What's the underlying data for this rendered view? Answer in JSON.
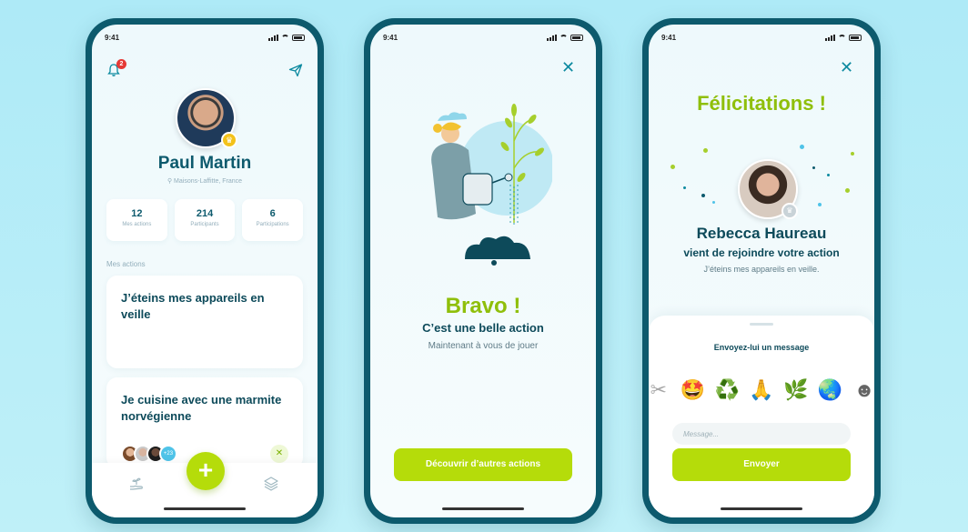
{
  "status_time": "9:41",
  "profile_screen": {
    "notification_count": "2",
    "user_name": "Paul Martin",
    "location": "Maisons-Laffitte, France",
    "stats": [
      {
        "value": "12",
        "label": "Mes actions"
      },
      {
        "value": "214",
        "label": "Participants"
      },
      {
        "value": "6",
        "label": "Participations"
      }
    ],
    "section_label": "Mes actions",
    "actions": [
      {
        "title": "J’éteins mes appareils en veille"
      },
      {
        "title": "Je cuisine avec une marmite norvégienne",
        "participants_more": "+23"
      }
    ],
    "fab_label": "+",
    "icons": {
      "notification": "bell-icon",
      "share": "paper-plane-icon",
      "tab_left": "plant-hand-icon",
      "tab_right": "layers-icon",
      "action": "utensils-icon"
    }
  },
  "bravo_screen": {
    "title": "Bravo !",
    "subtitle": "C’est une belle action",
    "caption": "Maintenant à vous de jouer",
    "cta_label": "Découvrir d’autres actions",
    "close_icon": "close-icon"
  },
  "congrats_screen": {
    "title": "Félicitations !",
    "user_name": "Rebecca Haureau",
    "subtitle": "vient de rejoindre votre action",
    "caption": "J’éteins mes appareils en veille.",
    "sheet_title": "Envoyez-lui un message",
    "emojis": [
      "🤩",
      "♻️",
      "🙏",
      "🌿",
      "🌏"
    ],
    "message_placeholder": "Message...",
    "send_label": "Envoyer"
  },
  "colors": {
    "brand_dark": "#0d5a6d",
    "accent_green": "#b5dc0a",
    "title_green": "#8fbf0a",
    "badge_red": "#e53935"
  }
}
